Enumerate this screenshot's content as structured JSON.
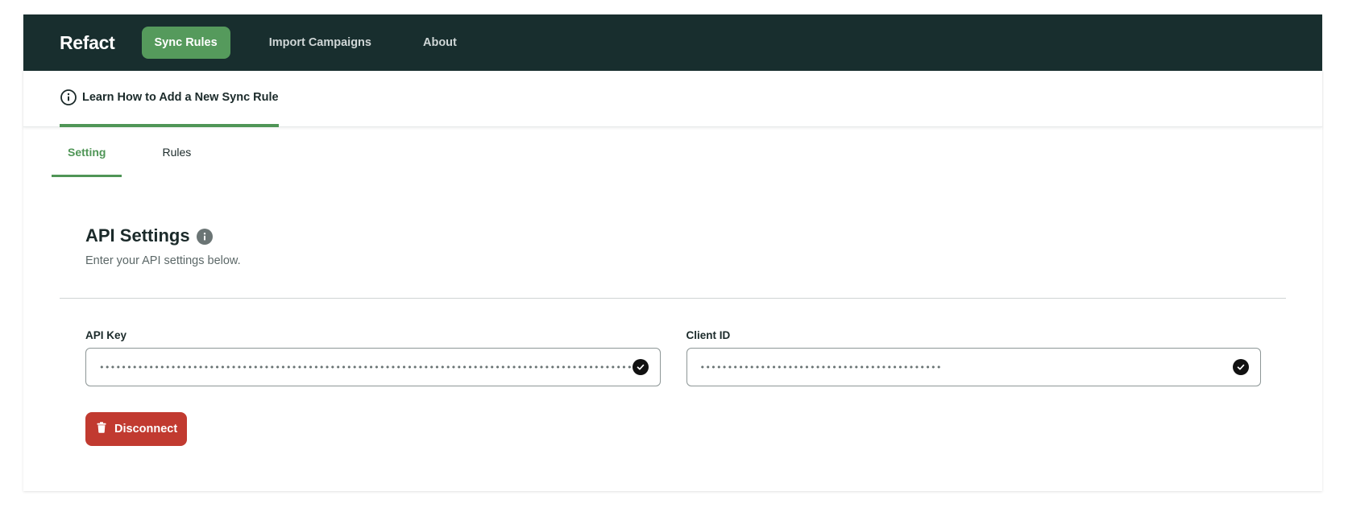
{
  "nav": {
    "brand": "Refact",
    "items": [
      {
        "label": "Sync Rules",
        "active": true
      },
      {
        "label": "Import Campaigns",
        "active": false
      },
      {
        "label": "About",
        "active": false
      }
    ]
  },
  "learn": {
    "label": "Learn How to Add a New Sync Rule"
  },
  "tabs": [
    {
      "label": "Setting",
      "active": true
    },
    {
      "label": "Rules",
      "active": false
    }
  ],
  "section": {
    "title": "API Settings",
    "subtitle": "Enter your API settings below."
  },
  "fields": {
    "api_key": {
      "label": "API Key",
      "value": "••••••••••••••••••••••••••••••••••••••••••••••••••••••••••••••••••••••••••••••••••••••••••••••••••"
    },
    "client_id": {
      "label": "Client ID",
      "value": "••••••••••••••••••••••••••••••••••••••••••••"
    }
  },
  "actions": {
    "disconnect_label": "Disconnect"
  },
  "colors": {
    "topbar": "#182e2e",
    "accent_green": "#4f9556",
    "danger": "#c13a30"
  }
}
